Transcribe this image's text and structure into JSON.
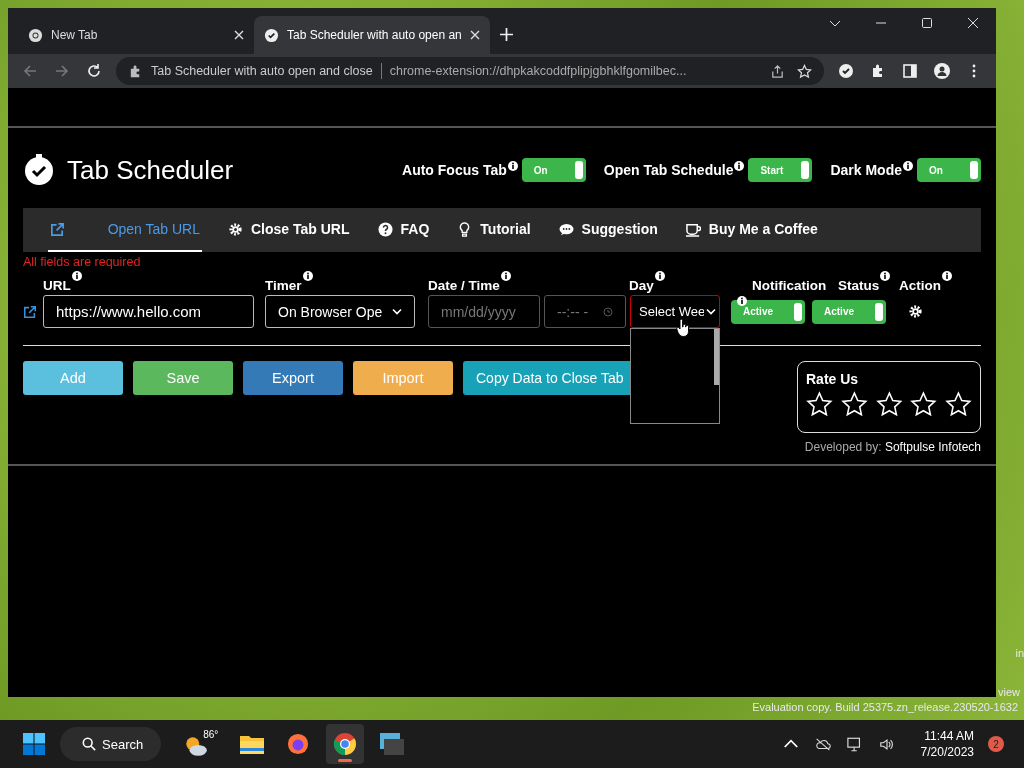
{
  "browser": {
    "tabs": [
      {
        "title": "New Tab",
        "selected": false
      },
      {
        "title": "Tab Scheduler with auto open an",
        "selected": true
      }
    ],
    "address": {
      "page_title": "Tab Scheduler with auto open and close",
      "url": "chrome-extension://dhpkakcoddfplipjgbhklfgomilbec..."
    }
  },
  "app": {
    "title": "Tab Scheduler",
    "toggles": [
      {
        "label": "Auto Focus Tab",
        "value": "On",
        "on": true
      },
      {
        "label": "Open Tab Schedule",
        "value": "Start",
        "on": true
      },
      {
        "label": "Dark Mode",
        "value": "On",
        "on": true
      }
    ],
    "nav": [
      {
        "label": "Open Tab URL",
        "kind": "link",
        "selected": true
      },
      {
        "label": "Close Tab URL",
        "kind": "gear",
        "selected": false
      },
      {
        "label": "FAQ",
        "kind": "question",
        "selected": false
      },
      {
        "label": "Tutorial",
        "kind": "bulb",
        "selected": false
      },
      {
        "label": "Suggestion",
        "kind": "chat",
        "selected": false
      },
      {
        "label": "Buy Me a Coffee",
        "kind": "cup",
        "selected": false
      }
    ],
    "error": "All fields are required",
    "columns": [
      {
        "label": "URL",
        "info": true
      },
      {
        "label": "Timer",
        "info": true
      },
      {
        "label": "Date / Time",
        "info": true
      },
      {
        "label": "Day",
        "info": true
      },
      {
        "label": "Notification",
        "info": true
      },
      {
        "label": "Status",
        "info": true
      },
      {
        "label": "Action",
        "info": true
      }
    ],
    "row": {
      "url": "https://www.hello.com",
      "timer": "On Browser Ope",
      "date_placeholder": "mm/dd/yyyy",
      "time_placeholder": "--:-- -",
      "day": "Select Wee",
      "day_open": true,
      "notification": {
        "label": "Active",
        "on": true
      },
      "status": {
        "label": "Active",
        "on": true
      }
    },
    "buttons": [
      {
        "label": "Add",
        "color": "#5bc0de"
      },
      {
        "label": "Save",
        "color": "#5cb85c"
      },
      {
        "label": "Export",
        "color": "#337ab7"
      },
      {
        "label": "Import",
        "color": "#f0ad4e"
      },
      {
        "label": "Copy Data to Close Tab",
        "color": "#17a2b8"
      }
    ],
    "rate": {
      "title": "Rate Us",
      "stars": 0
    },
    "developer": {
      "prefix": "Developed by:",
      "name": "Softpulse Infotech"
    }
  },
  "desktop": {
    "notes": [
      "in",
      "view",
      "Evaluation copy. Build 25375.zn_release.230520-1632"
    ]
  },
  "taskbar": {
    "search": "Search",
    "weather": "86°",
    "time": "11:44 AM",
    "date": "7/20/2023",
    "notifications": "2"
  }
}
